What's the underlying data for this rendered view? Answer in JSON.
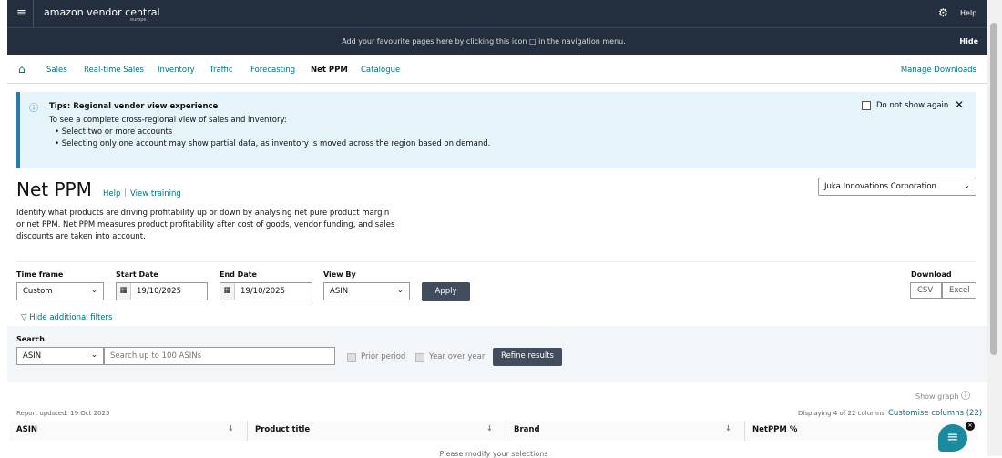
{
  "header": {
    "brand": "amazon vendor central",
    "region": "europe",
    "help": "Help"
  },
  "favourites": {
    "text": "Add your favourite pages here by clicking this icon □ in the navigation menu.",
    "hide": "Hide"
  },
  "nav": {
    "items": [
      "Sales",
      "Real-time Sales",
      "Inventory",
      "Traffic",
      "Forecasting",
      "Net PPM",
      "Catalogue"
    ],
    "active": "Net PPM",
    "manage_downloads": "Manage Downloads"
  },
  "tip": {
    "title": "Tips: Regional vendor view experience",
    "intro": "To see a complete cross-regional view of sales and inventory:",
    "bullets": [
      "Select two or more accounts",
      "Selecting only one account may show partial data, as inventory is moved across the region based on demand."
    ],
    "do_not_show": "Do not show again"
  },
  "page": {
    "title": "Net PPM",
    "help": "Help",
    "view_training": "View training",
    "description": "Identify what products are driving profitability up or down by analysing net pure product margin or net PPM. Net PPM measures product profitability after cost of goods, vendor funding, and sales discounts are taken into account.",
    "account": "Juka Innovations Corporation"
  },
  "filters": {
    "time_frame_label": "Time frame",
    "time_frame": "Custom",
    "start_label": "Start Date",
    "start": "19/10/2025",
    "end_label": "End Date",
    "end": "19/10/2025",
    "view_by_label": "View By",
    "view_by": "ASIN",
    "apply": "Apply",
    "download_label": "Download",
    "csv": "CSV",
    "excel": "Excel",
    "hide_filters": "Hide additional filters",
    "search_label": "Search",
    "search_type": "ASIN",
    "search_placeholder": "Search up to 100 ASINs",
    "prior_period": "Prior period",
    "yoy": "Year over year",
    "refine": "Refine results"
  },
  "report": {
    "show_graph": "Show graph",
    "updated": "Report updated: 19 Oct 2025",
    "displaying": "Displaying 4 of 22 columns",
    "customise": "Customise columns (22)",
    "columns": [
      "ASIN",
      "Product title",
      "Brand",
      "NetPPM %"
    ],
    "empty": "Please modify your selections"
  }
}
